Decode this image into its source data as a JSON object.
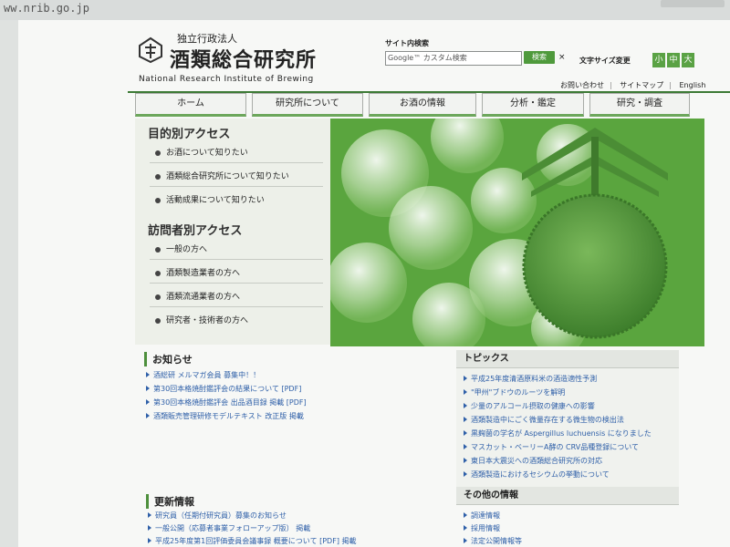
{
  "browser": {
    "url": "ww.nrib.go.jp"
  },
  "header": {
    "org_type": "独立行政法人",
    "org_name": "酒類総合研究所",
    "org_name_en": "National Research Institute of Brewing",
    "search_label": "サイト内検索",
    "search_placeholder": "Google™ カスタム検索",
    "search_button": "検索",
    "search_clear": "×",
    "fontsize_label": "文字サイズ変更",
    "fontsize_buttons": [
      "小",
      "中",
      "大"
    ],
    "util_links": [
      "お問い合わせ",
      "サイトマップ",
      "English"
    ]
  },
  "nav": {
    "tabs": [
      "ホーム",
      "研究所について",
      "お酒の情報",
      "分析・鑑定",
      "研究・調査"
    ]
  },
  "left_panel": {
    "purpose_heading": "目的別アクセス",
    "purpose_items": [
      "お酒について知りたい",
      "酒類総合研究所について知りたい",
      "活動成果について知りたい"
    ],
    "visitor_heading": "訪問者別アクセス",
    "visitor_items": [
      "一般の方へ",
      "酒類製造業者の方へ",
      "酒類流通業者の方へ",
      "研究者・技術者の方へ"
    ]
  },
  "news": {
    "heading": "お知らせ",
    "items": [
      "酒総研 メルマガ会員 募集中！！",
      "第30回本格焼酎鑑評会の結果について [PDF]",
      "第30回本格焼酎鑑評会 出品酒目録 掲載 [PDF]",
      "酒類販売管理研修モデルテキスト 改正版 掲載"
    ]
  },
  "updates": {
    "heading": "更新情報",
    "items": [
      "研究員（任期付研究員）募集のお知らせ",
      "一般公開（応募者事業フォローアップ版） 掲載",
      "平成25年度第1回評価委員会議事録  概要について [PDF] 掲載"
    ]
  },
  "topics": {
    "heading": "トピックス",
    "items": [
      "平成25年度清酒原料米の酒造適性予測",
      "\"甲州\"ブドウのルーツを解明",
      "少量のアルコール摂取の健康への影響",
      "酒類製造中にごく微量存在する微生物の検出法",
      "黒麹菌の学名が Aspergillus luchuensis になりました",
      "マスカット・ベーリーA酵の CRV品種登録について",
      "東日本大震災への酒類総合研究所の対応",
      "酒類製造におけるセシウムの挙動について"
    ]
  },
  "other": {
    "heading": "その他の情報",
    "items": [
      "調達情報",
      "採用情報",
      "法定公開情報等"
    ]
  },
  "colors": {
    "accent_green": "#4f9a3c",
    "link_blue": "#2e5fa8",
    "hero_green": "#5aa53e"
  }
}
